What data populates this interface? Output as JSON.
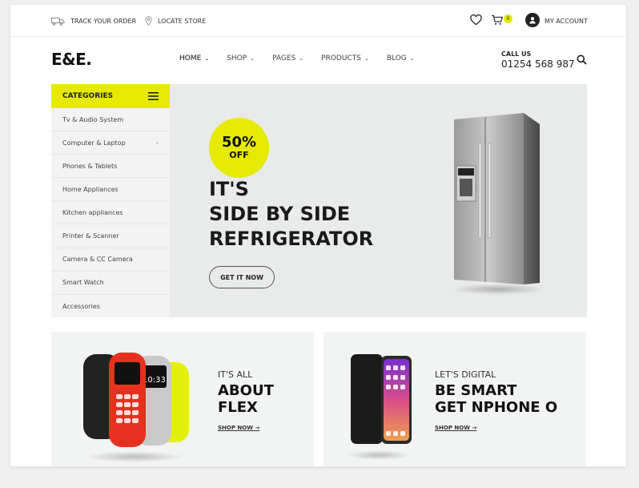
{
  "topbar": {
    "track_order": "TRACK YOUR ORDER",
    "locate_store": "LOCATE STORE",
    "cart_count": "0",
    "my_account": "MY ACCOUNT"
  },
  "header": {
    "logo": "E&E.",
    "nav": [
      {
        "label": "HOME"
      },
      {
        "label": "SHOP"
      },
      {
        "label": "PAGES"
      },
      {
        "label": "PRODUCTS"
      },
      {
        "label": "BLOG"
      }
    ],
    "call_label": "CALL US",
    "call_number": "01254 568 987"
  },
  "categories": {
    "title": "CATEGORIES",
    "items": [
      {
        "label": "Tv & Audio System"
      },
      {
        "label": "Computer & Laptop",
        "arrow": "›"
      },
      {
        "label": "Phones & Tablets"
      },
      {
        "label": "Home Appliances"
      },
      {
        "label": "Kitchen appliances"
      },
      {
        "label": "Printer & Scanner"
      },
      {
        "label": "Camera & CC Camera"
      },
      {
        "label": "Smart Watch"
      },
      {
        "label": "Accessories"
      }
    ]
  },
  "hero": {
    "badge_percent": "50%",
    "badge_off": "OFF",
    "title_lines": [
      "IT'S",
      "SIDE BY SIDE",
      "REFRIGERATOR"
    ],
    "button": "GET IT NOW"
  },
  "promos": [
    {
      "small": "IT'S ALL",
      "big1": "ABOUT",
      "big2": "FLEX",
      "link": "SHOP NOW →"
    },
    {
      "small": "LET'S DIGITAL",
      "big1": "BE SMART",
      "big2": "GET nPHONE O",
      "link": "SHOP NOW →"
    }
  ],
  "colors": {
    "accent": "#e6ea00",
    "panel": "#f3f3f3",
    "hero_bg": "#e9eaea"
  }
}
